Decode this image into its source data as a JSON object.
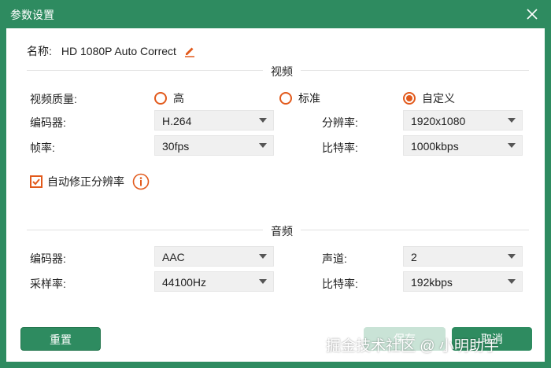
{
  "window": {
    "title": "参数设置"
  },
  "name": {
    "label": "名称:",
    "value": "HD 1080P Auto Correct"
  },
  "video": {
    "section_title": "视频",
    "quality_label": "视频质量:",
    "quality_options": [
      {
        "label": "高",
        "checked": false
      },
      {
        "label": "标准",
        "checked": false
      },
      {
        "label": "自定义",
        "checked": true
      }
    ],
    "encoder": {
      "label": "编码器:",
      "value": "H.264"
    },
    "framerate": {
      "label": "帧率:",
      "value": "30fps"
    },
    "resolution": {
      "label": "分辨率:",
      "value": "1920x1080"
    },
    "bitrate": {
      "label": "比特率:",
      "value": "1000kbps"
    },
    "auto_correct": {
      "label": "自动修正分辨率",
      "checked": true
    }
  },
  "audio": {
    "section_title": "音频",
    "encoder": {
      "label": "编码器:",
      "value": "AAC"
    },
    "samplerate": {
      "label": "采样率:",
      "value": "44100Hz"
    },
    "channel": {
      "label": "声道:",
      "value": "2"
    },
    "bitrate": {
      "label": "比特率:",
      "value": "192kbps"
    }
  },
  "buttons": {
    "reset": "重置",
    "save": "保存",
    "cancel": "取消"
  },
  "watermark": "掘金技术社区 @ 小明助手",
  "colors": {
    "accent": "#2e8b60",
    "radio": "#e25a1c",
    "field_bg": "#f0f0f0"
  },
  "icons": {
    "close": "close-icon",
    "edit": "pencil-icon",
    "info": "info-icon"
  }
}
